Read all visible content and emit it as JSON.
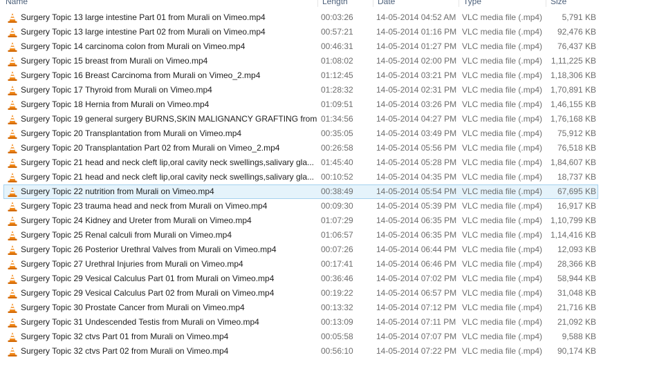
{
  "columns": {
    "name": "Name",
    "length": "Length",
    "date": "Date",
    "type": "Type",
    "size": "Size"
  },
  "files": [
    {
      "name": "Surgery Topic 13 large intestine Part 01 from Murali on Vimeo.mp4",
      "length": "00:03:26",
      "date": "14-05-2014 04:52 AM",
      "type": "VLC media file (.mp4)",
      "size": "5,791 KB",
      "icon": "vlc-icon"
    },
    {
      "name": "Surgery Topic 13 large intestine Part 02 from Murali on Vimeo.mp4",
      "length": "00:57:21",
      "date": "14-05-2014 01:16 PM",
      "type": "VLC media file (.mp4)",
      "size": "92,476 KB",
      "icon": "vlc-icon"
    },
    {
      "name": "Surgery Topic 14 carcinoma colon from Murali on Vimeo.mp4",
      "length": "00:46:31",
      "date": "14-05-2014 01:27 PM",
      "type": "VLC media file (.mp4)",
      "size": "76,437 KB",
      "icon": "vlc-icon"
    },
    {
      "name": "Surgery Topic 15 breast from Murali on Vimeo.mp4",
      "length": "01:08:02",
      "date": "14-05-2014 02:00 PM",
      "type": "VLC media file (.mp4)",
      "size": "1,11,225 KB",
      "icon": "vlc-icon"
    },
    {
      "name": "Surgery Topic 16 Breast Carcinoma from Murali on Vimeo_2.mp4",
      "length": "01:12:45",
      "date": "14-05-2014 03:21 PM",
      "type": "VLC media file (.mp4)",
      "size": "1,18,306 KB",
      "icon": "vlc-icon"
    },
    {
      "name": "Surgery Topic 17 Thyroid from Murali on Vimeo.mp4",
      "length": "01:28:32",
      "date": "14-05-2014 02:31 PM",
      "type": "VLC media file (.mp4)",
      "size": "1,70,891 KB",
      "icon": "vlc-icon"
    },
    {
      "name": "Surgery Topic 18 Hernia from Murali on Vimeo.mp4",
      "length": "01:09:51",
      "date": "14-05-2014 03:26 PM",
      "type": "VLC media file (.mp4)",
      "size": "1,46,155 KB",
      "icon": "vlc-icon"
    },
    {
      "name": "Surgery Topic 19 general surgery BURNS,SKIN MALIGNANCY GRAFTING from ...",
      "length": "01:34:56",
      "date": "14-05-2014 04:27 PM",
      "type": "VLC media file (.mp4)",
      "size": "1,76,168 KB",
      "icon": "vlc-icon"
    },
    {
      "name": "Surgery Topic 20 Transplantation from Murali on Vimeo.mp4",
      "length": "00:35:05",
      "date": "14-05-2014 03:49 PM",
      "type": "VLC media file (.mp4)",
      "size": "75,912 KB",
      "icon": "vlc-icon"
    },
    {
      "name": "Surgery Topic 20 Transplantation Part 02 from Murali on Vimeo_2.mp4",
      "length": "00:26:58",
      "date": "14-05-2014 05:56 PM",
      "type": "VLC media file (.mp4)",
      "size": "76,518 KB",
      "icon": "vlc-icon"
    },
    {
      "name": "Surgery Topic 21 head and neck cleft lip,oral cavity neck swellings,salivary gla...",
      "length": "01:45:40",
      "date": "14-05-2014 05:28 PM",
      "type": "VLC media file (.mp4)",
      "size": "1,84,607 KB",
      "icon": "vlc-icon"
    },
    {
      "name": "Surgery Topic 21 head and neck cleft lip,oral cavity neck swellings,salivary gla...",
      "length": "00:10:52",
      "date": "14-05-2014 04:35 PM",
      "type": "VLC media file (.mp4)",
      "size": "18,737 KB",
      "icon": "vlc-icon"
    },
    {
      "name": "Surgery Topic 22 nutrition from Murali on Vimeo.mp4",
      "length": "00:38:49",
      "date": "14-05-2014 05:54 PM",
      "type": "VLC media file (.mp4)",
      "size": "67,695 KB",
      "icon": "vlc-icon",
      "selected": true
    },
    {
      "name": "Surgery Topic 23 trauma head and neck from Murali on Vimeo.mp4",
      "length": "00:09:30",
      "date": "14-05-2014 05:39 PM",
      "type": "VLC media file (.mp4)",
      "size": "16,917 KB",
      "icon": "vlc-icon"
    },
    {
      "name": "Surgery Topic 24 Kidney and Ureter from Murali on Vimeo.mp4",
      "length": "01:07:29",
      "date": "14-05-2014 06:35 PM",
      "type": "VLC media file (.mp4)",
      "size": "1,10,799 KB",
      "icon": "vlc-icon"
    },
    {
      "name": "Surgery Topic 25 Renal calculi from Murali on Vimeo.mp4",
      "length": "01:06:57",
      "date": "14-05-2014 06:35 PM",
      "type": "VLC media file (.mp4)",
      "size": "1,14,416 KB",
      "icon": "vlc-icon"
    },
    {
      "name": "Surgery Topic 26 Posterior Urethral Valves from Murali on Vimeo.mp4",
      "length": "00:07:26",
      "date": "14-05-2014 06:44 PM",
      "type": "VLC media file (.mp4)",
      "size": "12,093 KB",
      "icon": "vlc-icon"
    },
    {
      "name": "Surgery Topic 27 Urethral Injuries from Murali on Vimeo.mp4",
      "length": "00:17:41",
      "date": "14-05-2014 06:46 PM",
      "type": "VLC media file (.mp4)",
      "size": "28,366 KB",
      "icon": "vlc-icon"
    },
    {
      "name": "Surgery Topic 29 Vesical Calculus Part 01 from Murali on Vimeo.mp4",
      "length": "00:36:46",
      "date": "14-05-2014 07:02 PM",
      "type": "VLC media file (.mp4)",
      "size": "58,944 KB",
      "icon": "vlc-icon"
    },
    {
      "name": "Surgery Topic 29 Vesical Calculus Part 02 from Murali on Vimeo.mp4",
      "length": "00:19:22",
      "date": "14-05-2014 06:57 PM",
      "type": "VLC media file (.mp4)",
      "size": "31,048 KB",
      "icon": "vlc-icon"
    },
    {
      "name": "Surgery Topic 30 Prostate Cancer from Murali on Vimeo.mp4",
      "length": "00:13:32",
      "date": "14-05-2014 07:12 PM",
      "type": "VLC media file (.mp4)",
      "size": "21,716 KB",
      "icon": "vlc-icon"
    },
    {
      "name": "Surgery Topic 31 Undescended Testis from Murali on Vimeo.mp4",
      "length": "00:13:09",
      "date": "14-05-2014 07:11 PM",
      "type": "VLC media file (.mp4)",
      "size": "21,092 KB",
      "icon": "vlc-icon"
    },
    {
      "name": "Surgery Topic 32 ctvs Part 01 from Murali on Vimeo.mp4",
      "length": "00:05:58",
      "date": "14-05-2014 07:07 PM",
      "type": "VLC media file (.mp4)",
      "size": "9,588 KB",
      "icon": "vlc-icon"
    },
    {
      "name": "Surgery Topic 32 ctvs Part 02 from Murali on Vimeo.mp4",
      "length": "00:56:10",
      "date": "14-05-2014 07:22 PM",
      "type": "VLC media file (.mp4)",
      "size": "90,174 KB",
      "icon": "vlc-icon"
    }
  ],
  "colors": {
    "selection_bg": "#e5f3fb",
    "selection_border": "#a5d1ee",
    "header_text": "#4c607a",
    "vlc_orange": "#f28a1b"
  }
}
